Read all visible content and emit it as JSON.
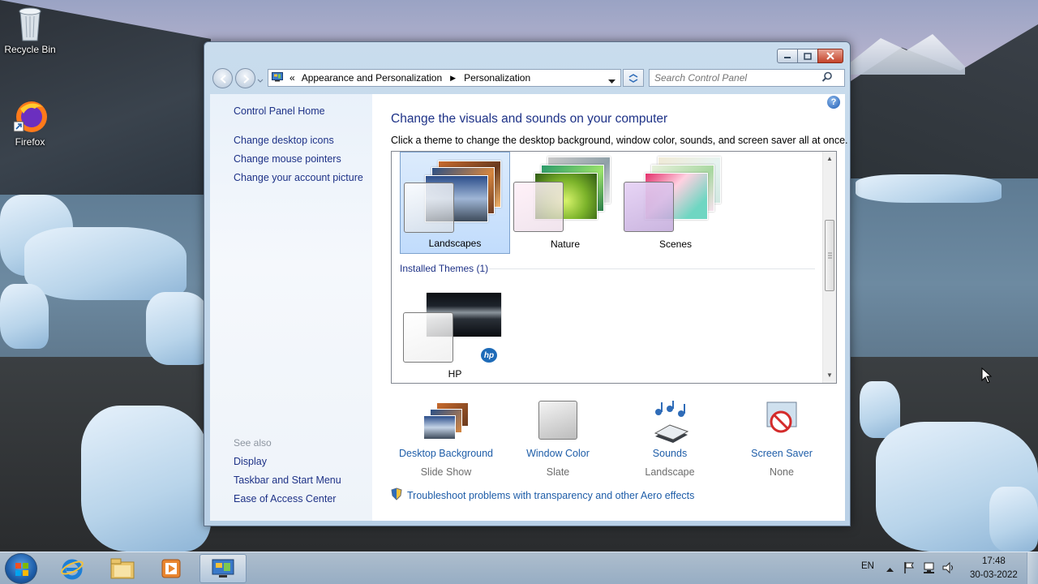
{
  "desktop": {
    "icons": [
      {
        "label": "Recycle Bin"
      },
      {
        "label": "Firefox"
      }
    ]
  },
  "window": {
    "address": {
      "crumbs": [
        "Appearance and Personalization",
        "Personalization"
      ],
      "overflow": "«"
    },
    "search": {
      "placeholder": "Search Control Panel"
    },
    "sidebar": {
      "links": [
        "Control Panel Home",
        "Change desktop icons",
        "Change mouse pointers",
        "Change your account picture"
      ],
      "see_also_heading": "See also",
      "see_also": [
        "Display",
        "Taskbar and Start Menu",
        "Ease of Access Center"
      ]
    },
    "content": {
      "title": "Change the visuals and sounds on your computer",
      "subtitle": "Click a theme to change the desktop background, window color, sounds, and screen saver all at once.",
      "themes": [
        {
          "name": "Landscapes",
          "selected": true
        },
        {
          "name": "Nature",
          "selected": false
        },
        {
          "name": "Scenes",
          "selected": false
        }
      ],
      "installed_heading": "Installed Themes (1)",
      "installed": [
        {
          "name": "HP",
          "brand": "hp"
        }
      ],
      "bottom": [
        {
          "link": "Desktop Background",
          "value": "Slide Show"
        },
        {
          "link": "Window Color",
          "value": "Slate"
        },
        {
          "link": "Sounds",
          "value": "Landscape"
        },
        {
          "link": "Screen Saver",
          "value": "None"
        }
      ],
      "troubleshoot": "Troubleshoot problems with transparency and other Aero effects"
    }
  },
  "taskbar": {
    "language": "EN",
    "time": "17:48",
    "date": "30-03-2022"
  },
  "colors": {
    "link": "#1e3287",
    "selected_theme_bg": "#c1dcfc",
    "close_button": "#c4432a"
  }
}
